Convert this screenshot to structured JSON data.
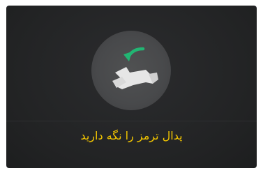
{
  "display": {
    "instruction_text": "پدال ترمز را نگه دارید",
    "icon": "brake-pedal-press-icon",
    "text_color": "#f2c500",
    "accent_color": "#22b573",
    "background_color": "#242526"
  }
}
